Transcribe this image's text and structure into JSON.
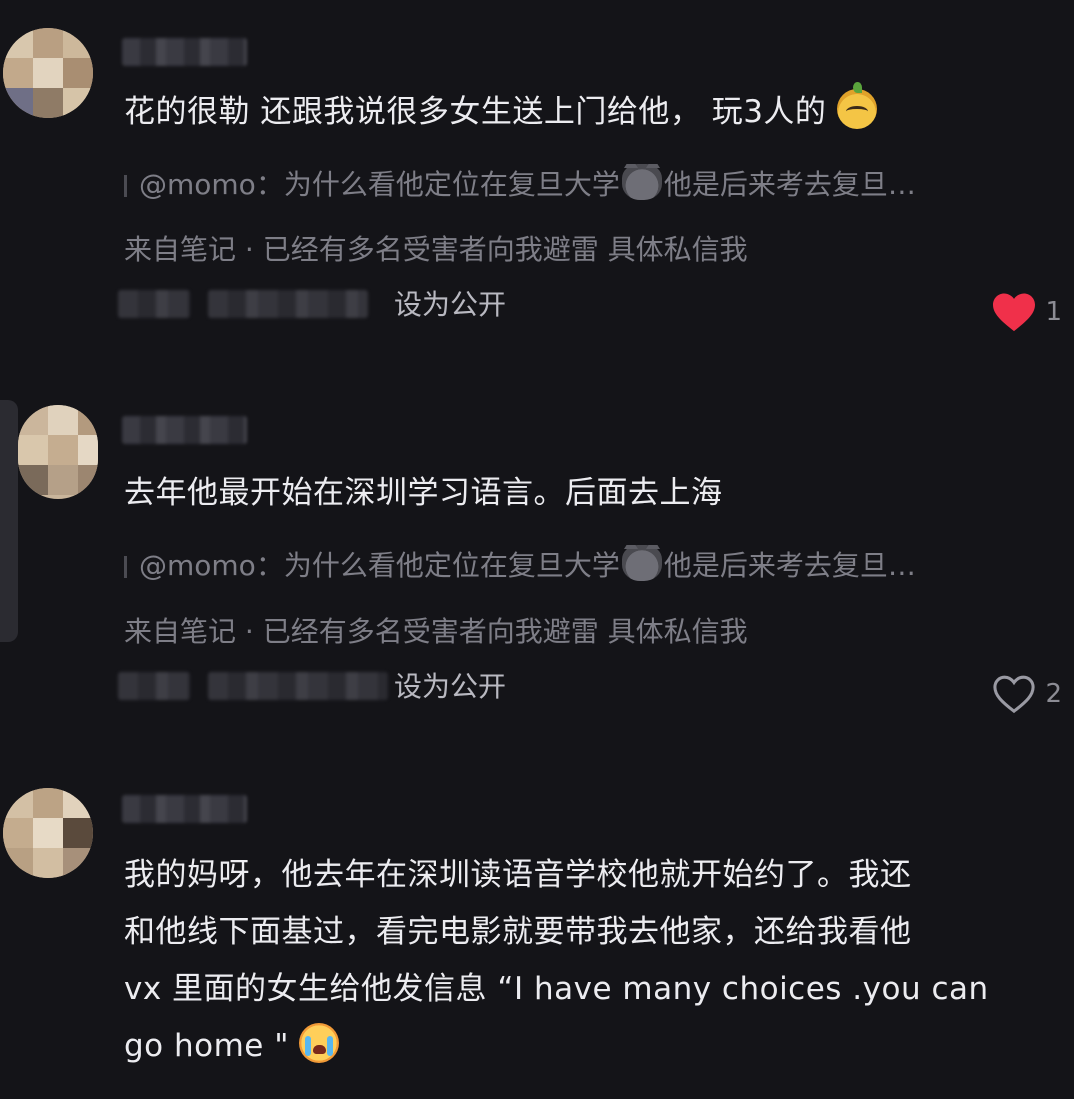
{
  "comments": [
    {
      "text": "花的很勒 还跟我说很多女生送上门给他， 玩3人的",
      "reply_to": "@momo：为什么看他定位在复旦大学",
      "reply_tail": "他是后来考去复旦…",
      "source": "来自笔记 · 已经有多名受害者向我避雷 具体私信我",
      "action": "设为公开",
      "like_count": "1",
      "liked": true
    },
    {
      "text": "去年他最开始在深圳学习语言。后面去上海",
      "reply_to": "@momo：为什么看他定位在复旦大学",
      "reply_tail": "他是后来考去复旦…",
      "source": "来自笔记 · 已经有多名受害者向我避雷 具体私信我",
      "action": "设为公开",
      "like_count": "2",
      "liked": false
    },
    {
      "lines": [
        "我的妈呀，他去年在深圳读语音学校他就开始约了。我还",
        "和他线下面基过，看完电影就要带我去他家，还给我看他",
        "vx 里面的女生给他发信息 “I have many choices .you can",
        "go home \""
      ]
    }
  ],
  "colors": {
    "background": "#141418",
    "text": "#ececf0",
    "muted": "#7e7e87",
    "like_active": "#f0304a"
  },
  "icons": {
    "liked": "heart-filled-icon",
    "unliked": "heart-outline-icon",
    "emoji_1": "mango-face-emoji",
    "emoji_reply": "cat-face-emoji",
    "emoji_3": "crying-face-emoji"
  }
}
